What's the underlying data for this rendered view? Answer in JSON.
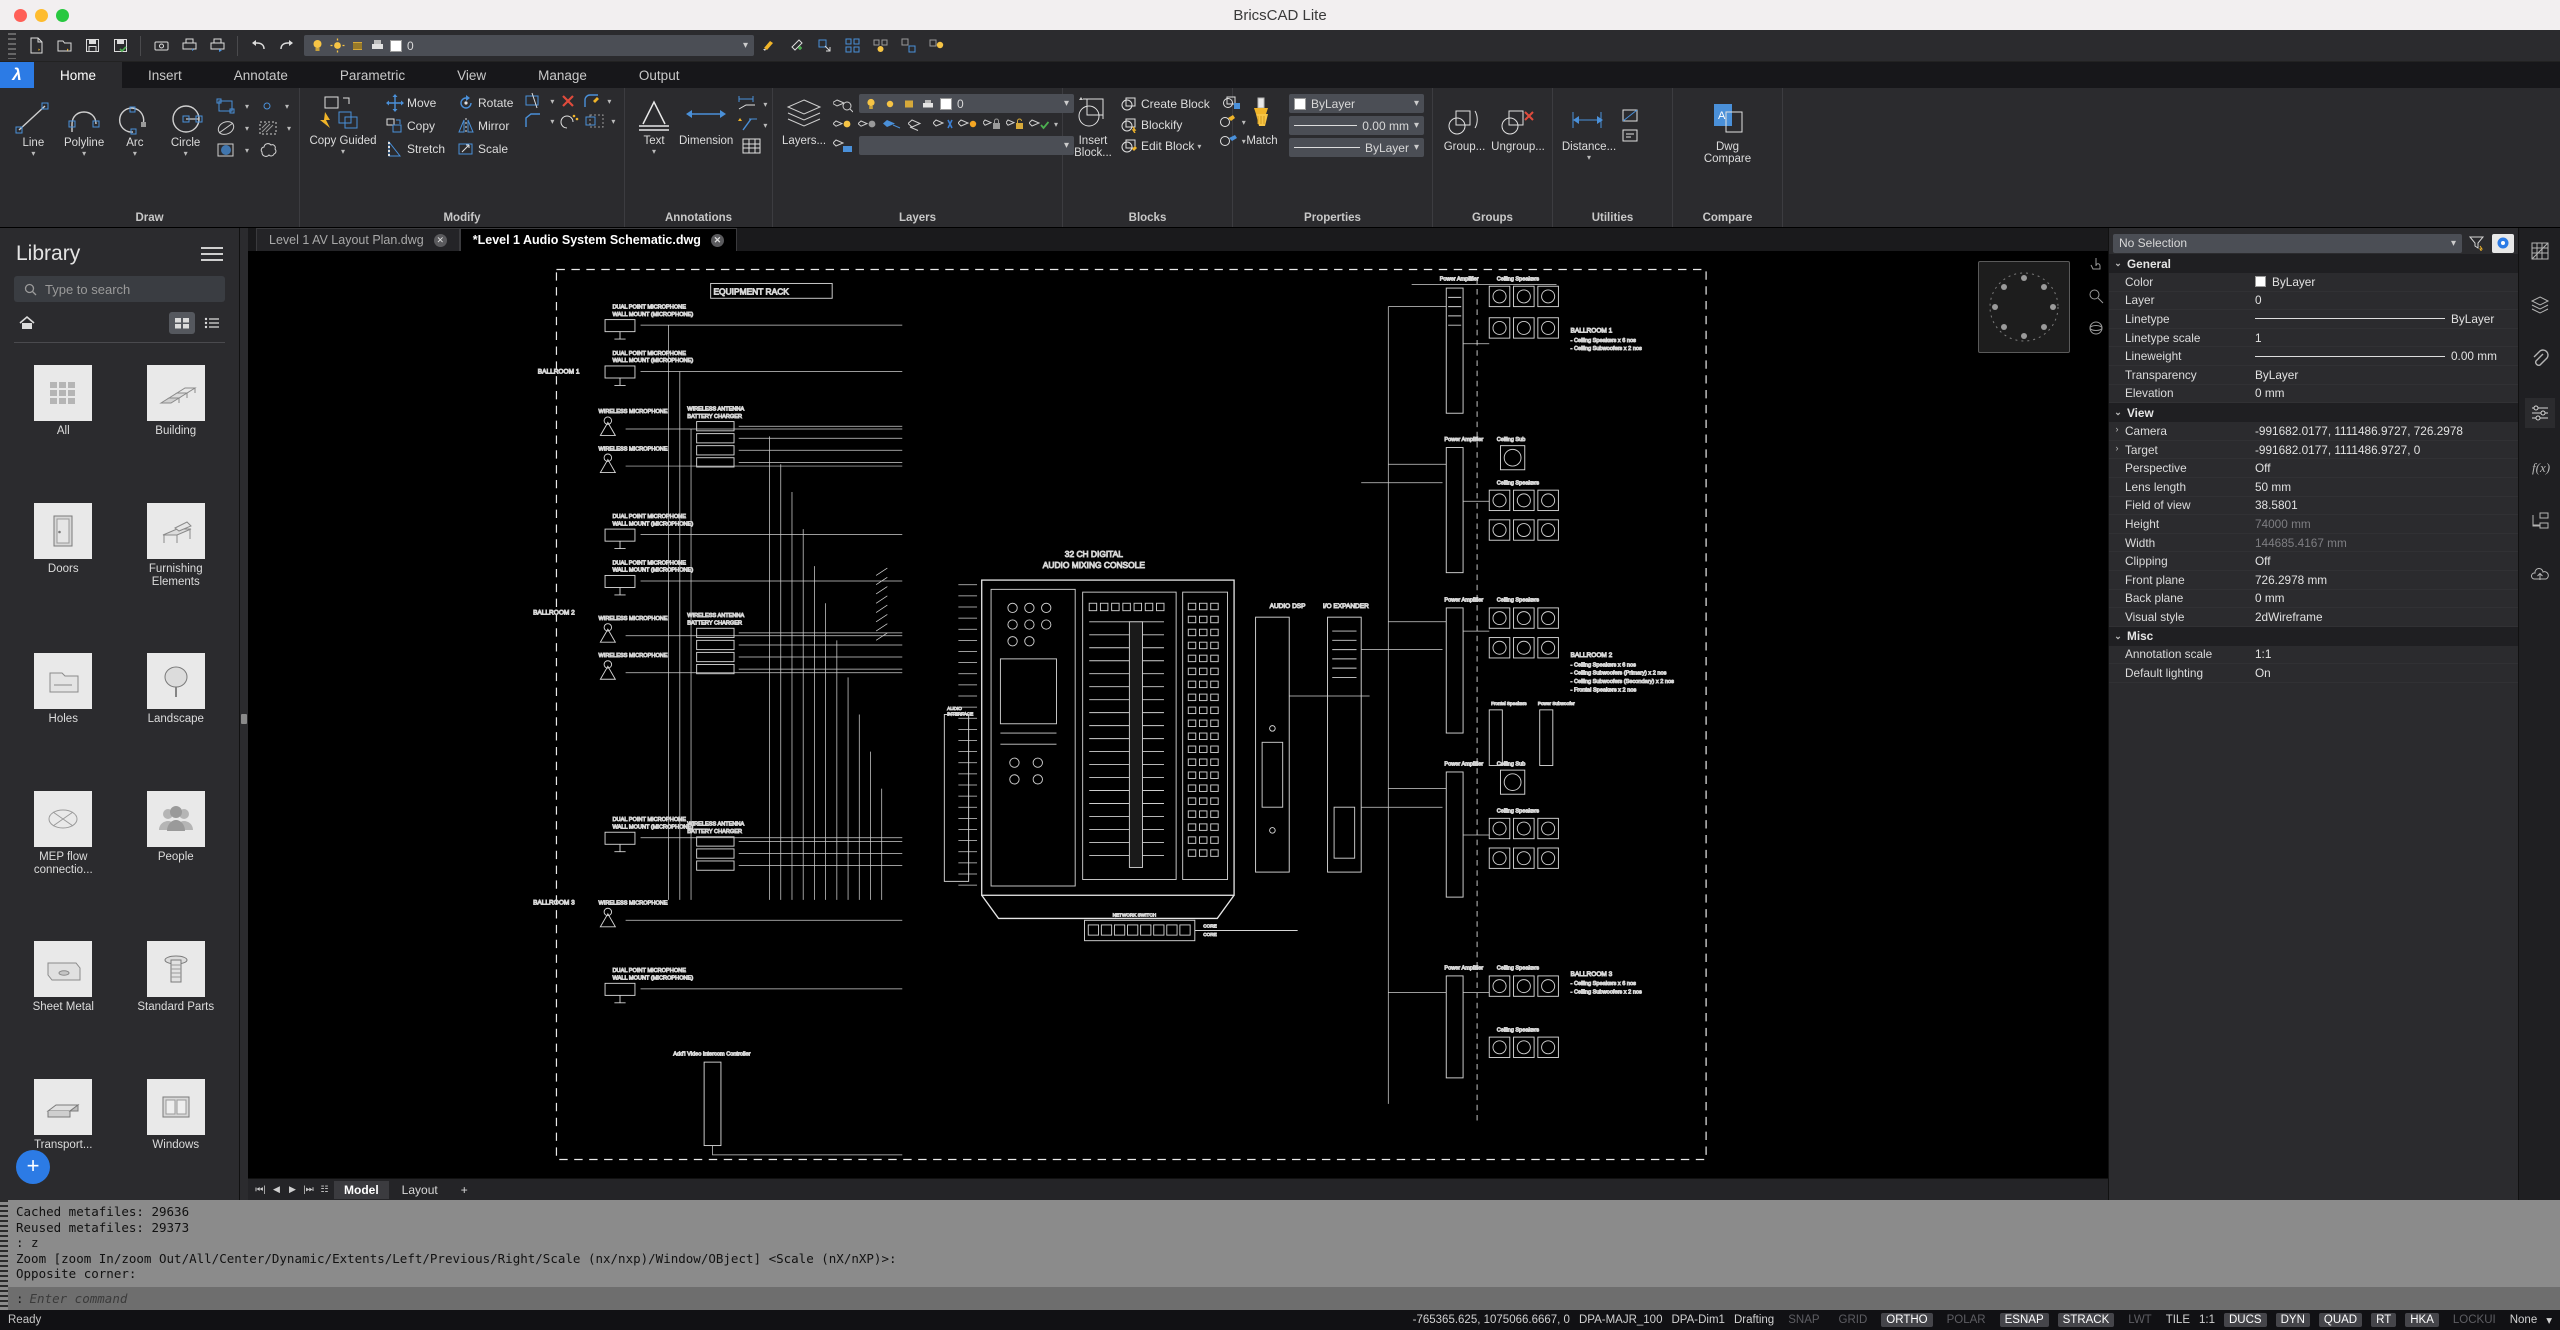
{
  "window": {
    "title": "BricsCAD Lite"
  },
  "quick_access": {
    "icons": [
      "new-file-icon",
      "open-file-icon",
      "save-icon",
      "save-as-icon",
      "plot-preview-icon",
      "plot-icon",
      "publish-icon",
      "undo-icon",
      "redo-icon"
    ],
    "layer_value": "0",
    "right_icons": [
      "match-properties-icon",
      "eyedropper-icon",
      "select-similar-icon",
      "selection-grid-icon",
      "layer-state-icon",
      "select-all-icon",
      "lightbulb-icon"
    ]
  },
  "ribbon": {
    "tabs": [
      {
        "label": "Home",
        "active": true
      },
      {
        "label": "Insert",
        "active": false
      },
      {
        "label": "Annotate",
        "active": false
      },
      {
        "label": "Parametric",
        "active": false
      },
      {
        "label": "View",
        "active": false
      },
      {
        "label": "Manage",
        "active": false
      },
      {
        "label": "Output",
        "active": false
      }
    ],
    "panels": {
      "draw": {
        "title": "Draw",
        "big": [
          {
            "label": "Line",
            "icon": "line-icon"
          },
          {
            "label": "Polyline",
            "icon": "polyline-icon"
          },
          {
            "label": "Arc",
            "icon": "arc-icon"
          },
          {
            "label": "Circle",
            "icon": "circle-icon"
          }
        ],
        "small_icons": [
          "rectangle-icon",
          "point-icon",
          "ellipse-icon",
          "hatch-icon",
          "gradient-icon",
          "revision-cloud-icon"
        ]
      },
      "modify": {
        "title": "Modify",
        "copy_guided": "Copy Guided",
        "items": [
          {
            "label": "Move",
            "icon": "move-icon"
          },
          {
            "label": "Rotate",
            "icon": "rotate-icon"
          },
          {
            "label": "Copy",
            "icon": "copy-icon"
          },
          {
            "label": "Mirror",
            "icon": "mirror-icon"
          },
          {
            "label": "Stretch",
            "icon": "stretch-icon"
          },
          {
            "label": "Scale",
            "icon": "scale-icon"
          }
        ],
        "extra_icons": [
          "trim-icon",
          "erase-icon",
          "fillet-icon",
          "chamfer-icon",
          "array-icon",
          "offset-icon"
        ]
      },
      "annotations": {
        "title": "Annotations",
        "text": "Text",
        "dimension": "Dimension",
        "icons": [
          "text-icon",
          "dimension-icon",
          "leader-icon",
          "multileader-icon",
          "table-icon"
        ]
      },
      "layers": {
        "title": "Layers",
        "layers_btn": "Layers...",
        "current_layer": "0",
        "filter_value": "",
        "icons": [
          "layers-icon",
          "layer-inspect-icon",
          "layer-on-icon",
          "layer-off-icon",
          "layer-freeze-icon",
          "layer-thaw-icon",
          "layer-isolate-icon",
          "layer-unisolate-icon",
          "layer-lock-icon",
          "layer-unlock-icon",
          "layer-merge-icon"
        ]
      },
      "blocks": {
        "title": "Blocks",
        "insert_block": "Insert Block...",
        "create_block": "Create Block",
        "blockify": "Blockify",
        "edit_block": "Edit Block",
        "icons": [
          "insert-block-icon",
          "create-block-icon",
          "blockify-icon",
          "edit-block-icon",
          "write-block-icon",
          "explode-block-icon",
          "block-attribute-icon"
        ]
      },
      "properties": {
        "title": "Properties",
        "match": "Match",
        "color": "ByLayer",
        "lineweight": "0.00 mm",
        "linetype": "ByLayer"
      },
      "groups": {
        "title": "Groups",
        "group": "Group...",
        "ungroup": "Ungroup..."
      },
      "utilities": {
        "title": "Utilities",
        "distance": "Distance..."
      },
      "compare": {
        "title": "Compare",
        "dwg_compare": "Dwg\nCompare"
      }
    }
  },
  "library": {
    "title": "Library",
    "search_placeholder": "Type to search",
    "items": [
      {
        "label": "All",
        "icon": "all-grid-icon"
      },
      {
        "label": "Building",
        "icon": "building-stairs-icon"
      },
      {
        "label": "Doors",
        "icon": "door-icon"
      },
      {
        "label": "Furnishing Elements",
        "icon": "furniture-chair-icon"
      },
      {
        "label": "Holes",
        "icon": "holes-icon"
      },
      {
        "label": "Landscape",
        "icon": "tree-icon"
      },
      {
        "label": "MEP flow connectio...",
        "icon": "mep-flow-icon"
      },
      {
        "label": "People",
        "icon": "people-icon"
      },
      {
        "label": "Sheet Metal",
        "icon": "sheet-metal-icon"
      },
      {
        "label": "Standard Parts",
        "icon": "screw-icon"
      },
      {
        "label": "Transport...",
        "icon": "transport-icon"
      },
      {
        "label": "Windows",
        "icon": "window-icon"
      }
    ],
    "add_button": "+"
  },
  "document_tabs": [
    {
      "label": "Level 1 AV Layout Plan.dwg",
      "active": false,
      "modified": false
    },
    {
      "label": "*Level 1 Audio System Schematic.dwg",
      "active": true,
      "modified": true
    }
  ],
  "drawing": {
    "title_block": "EQUIPMENT RACK",
    "console_label_line1": "32 CH DIGITAL",
    "console_label_line2": "AUDIO MIXING CONSOLE",
    "labels": [
      {
        "text": "EQUIPMENT RACK"
      },
      {
        "text": "BALLROOM 1"
      },
      {
        "text": "BALLROOM 2"
      },
      {
        "text": "BALLROOM 3"
      },
      {
        "text": "AUDIO DSP"
      },
      {
        "text": "I/O EXPANDER"
      },
      {
        "text": "Power Amplifier"
      },
      {
        "text": "Ceiling Speakers"
      },
      {
        "text": "Ceiling Sub"
      },
      {
        "text": "NETWORK SWITCH"
      }
    ],
    "notes": [
      "BALLROOM 1",
      "- Ceiling Speakers x 6 nos",
      "- Ceiling Subwoofers x 2 nos",
      "BALLROOM 2",
      "- Ceiling Speakers x 6 nos",
      "- Ceiling Subwoofers (Primary) x 2 nos",
      "- Ceiling Subwoofers (Secondary) x 2 nos",
      "- Frontal Speakers x 2 nos",
      "BALLROOM 3",
      "- Ceiling Speakers x 6 nos",
      "- Ceiling Subwoofers x 2 nos"
    ],
    "mic_labels": [
      "DUAL POINT MICROPHONE",
      "WALL MOUNT (MICROPHONE)",
      "WIRELESS MICROPHONE",
      "WIRELESS ANTENNA",
      "BATTERY CHARGER"
    ]
  },
  "model_bar": {
    "nav": [
      "first-icon",
      "prev-icon",
      "next-icon",
      "last-icon"
    ],
    "tabs": [
      {
        "label": "Model",
        "selected": true
      },
      {
        "label": "Layout",
        "selected": false
      }
    ],
    "add": "+"
  },
  "properties_panel": {
    "selection": "No Selection",
    "header_icons": [
      "filter-icon",
      "quick-select-icon"
    ],
    "groups": [
      {
        "name": "General",
        "rows": [
          {
            "name": "Color",
            "value": "ByLayer",
            "type": "color"
          },
          {
            "name": "Layer",
            "value": "0",
            "type": "text"
          },
          {
            "name": "Linetype",
            "value": "ByLayer",
            "type": "linetype"
          },
          {
            "name": "Linetype scale",
            "value": "1",
            "type": "text"
          },
          {
            "name": "Lineweight",
            "value": "0.00 mm",
            "type": "linetype"
          },
          {
            "name": "Transparency",
            "value": "ByLayer",
            "type": "text"
          },
          {
            "name": "Elevation",
            "value": "0 mm",
            "type": "text"
          }
        ]
      },
      {
        "name": "View",
        "rows": [
          {
            "name": "Camera",
            "value": "-991682.0177, 1111486.9727, 726.2978",
            "type": "text",
            "expandable": true
          },
          {
            "name": "Target",
            "value": "-991682.0177, 1111486.9727, 0",
            "type": "text",
            "expandable": true
          },
          {
            "name": "Perspective",
            "value": "Off",
            "type": "text"
          },
          {
            "name": "Lens length",
            "value": "50 mm",
            "type": "text"
          },
          {
            "name": "Field of view",
            "value": "38.5801",
            "type": "text"
          },
          {
            "name": "Height",
            "value": "74000 mm",
            "type": "text",
            "dim": true
          },
          {
            "name": "Width",
            "value": "144685.4167 mm",
            "type": "text",
            "dim": true
          },
          {
            "name": "Clipping",
            "value": "Off",
            "type": "text"
          },
          {
            "name": "Front plane",
            "value": "726.2978 mm",
            "type": "text"
          },
          {
            "name": "Back plane",
            "value": "0 mm",
            "type": "text"
          },
          {
            "name": "Visual style",
            "value": "2dWireframe",
            "type": "text"
          }
        ]
      },
      {
        "name": "Misc",
        "rows": [
          {
            "name": "Annotation scale",
            "value": "1:1",
            "type": "text"
          },
          {
            "name": "Default lighting",
            "value": "On",
            "type": "text"
          }
        ]
      }
    ],
    "rail_icons": [
      "sheet-set-icon",
      "layers-panel-icon",
      "attachments-icon",
      "parameters-icon",
      "formula-icon",
      "structure-icon",
      "cloud-upload-icon"
    ]
  },
  "command_line": {
    "history": [
      "Cached metafiles: 29636",
      "Reused metafiles: 29373",
      ": z",
      "Zoom [zoom In/zoom Out/All/Center/Dynamic/Extents/Left/Previous/Right/Scale (nx/nxp)/Window/OBject] <Scale (nX/nXP)>:",
      "Opposite corner:"
    ],
    "prompt_prefix": ":",
    "placeholder": "Enter command"
  },
  "status_bar": {
    "left": "Ready",
    "coordinates": "-765365.625, 1075066.6667, 0",
    "dim_style": "DPA-MAJR_100",
    "dim_style2": "DPA-Dim1",
    "workspace": "Drafting",
    "toggles": [
      {
        "label": "SNAP",
        "on": false
      },
      {
        "label": "GRID",
        "on": false
      },
      {
        "label": "ORTHO",
        "on": true
      },
      {
        "label": "POLAR",
        "on": false
      },
      {
        "label": "ESNAP",
        "on": true
      },
      {
        "label": "STRACK",
        "on": true
      },
      {
        "label": "LWT",
        "on": false
      },
      {
        "label": "TILE",
        "on": false,
        "plain": true
      },
      {
        "label": "1:1",
        "on": false,
        "plain": true
      },
      {
        "label": "DUCS",
        "on": true
      },
      {
        "label": "DYN",
        "on": true
      },
      {
        "label": "QUAD",
        "on": true
      },
      {
        "label": "RT",
        "on": true
      },
      {
        "label": "HKA",
        "on": true
      },
      {
        "label": "LOCKUI",
        "on": false
      },
      {
        "label": "None",
        "on": false,
        "plain": true
      }
    ]
  },
  "colors": {
    "accent": "#2c7be5",
    "ribbon_bg": "#2b2b2e",
    "canvas_bg": "#000000",
    "cmd_bg": "#8b8b8b",
    "status_bg": "#111114",
    "titlebar_bg": "#f2eff0"
  }
}
